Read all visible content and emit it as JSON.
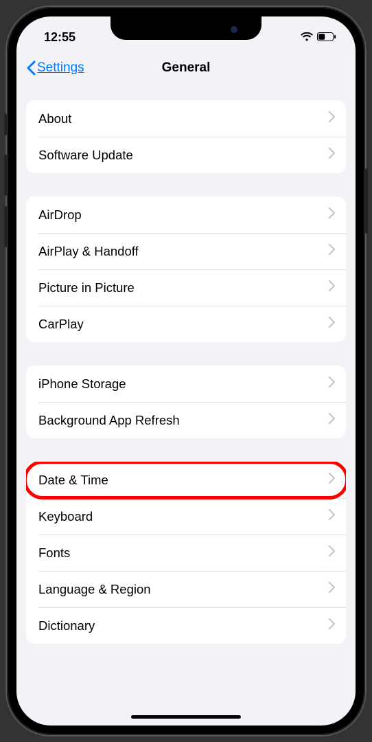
{
  "status": {
    "time": "12:55"
  },
  "header": {
    "back_label": "Settings",
    "title": "General"
  },
  "groups": [
    {
      "items": [
        {
          "label": "About"
        },
        {
          "label": "Software Update"
        }
      ]
    },
    {
      "items": [
        {
          "label": "AirDrop"
        },
        {
          "label": "AirPlay & Handoff"
        },
        {
          "label": "Picture in Picture"
        },
        {
          "label": "CarPlay"
        }
      ]
    },
    {
      "items": [
        {
          "label": "iPhone Storage"
        },
        {
          "label": "Background App Refresh"
        }
      ]
    },
    {
      "items": [
        {
          "label": "Date & Time",
          "highlighted": true
        },
        {
          "label": "Keyboard"
        },
        {
          "label": "Fonts"
        },
        {
          "label": "Language & Region"
        },
        {
          "label": "Dictionary"
        }
      ]
    }
  ]
}
